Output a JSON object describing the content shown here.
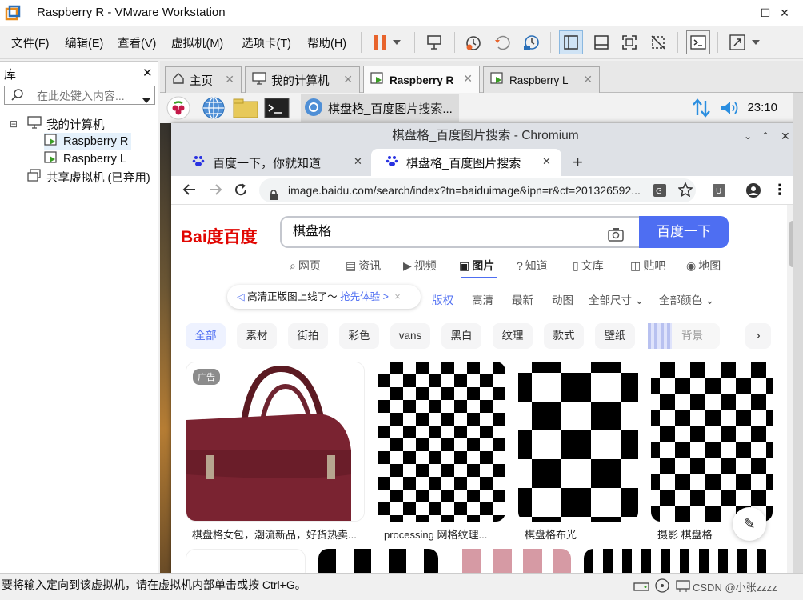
{
  "window": {
    "title": "Raspberry R - VMware Workstation",
    "minimize": "—",
    "maximize": "☐",
    "close": "✕"
  },
  "menu": [
    "文件(F)",
    "编辑(E)",
    "查看(V)",
    "虚拟机(M)",
    "选项卡(T)",
    "帮助(H)"
  ],
  "library": {
    "title": "库",
    "close": "✕",
    "search_placeholder": "在此处键入内容...",
    "tree": [
      {
        "label": "我的计算机",
        "expander": "⊟"
      },
      {
        "label": "Raspberry R"
      },
      {
        "label": "Raspberry L"
      },
      {
        "label": "共享虚拟机 (已弃用)"
      }
    ]
  },
  "vm_tabs": [
    {
      "label": "主页",
      "close": "✕"
    },
    {
      "label": "我的计算机",
      "close": "✕"
    },
    {
      "label": "Raspberry R",
      "close": "✕"
    },
    {
      "label": "Raspberry L",
      "close": "✕"
    }
  ],
  "guest_panel": {
    "taskbar_item": "棋盘格_百度图片搜索...",
    "clock": "23:10"
  },
  "chromium": {
    "title": "棋盘格_百度图片搜索 - Chromium",
    "tabs": [
      {
        "label": "百度一下，你就知道",
        "close": "✕"
      },
      {
        "label": "棋盘格_百度图片搜索",
        "close": "✕"
      }
    ],
    "new_tab": "+",
    "url": "image.baidu.com/search/index?tn=baiduimage&ipn=r&ct=201326592..."
  },
  "baidu": {
    "logo": "Bai度百度",
    "query": "棋盘格",
    "search_button": "百度一下",
    "nav": [
      "网页",
      "资讯",
      "视频",
      "图片",
      "知道",
      "文库",
      "贴吧",
      "地图"
    ],
    "notice": "高清正版图上线了～",
    "notice_link": "抢先体验 >",
    "filters": [
      "版权",
      "高清",
      "最新",
      "动图",
      "全部尺寸",
      "全部颜色"
    ],
    "chips": [
      "全部",
      "素材",
      "街拍",
      "彩色",
      "vans",
      "黑白",
      "纹理",
      "款式",
      "壁纸",
      "背景"
    ],
    "ad_badge": "广告",
    "captions": [
      "棋盘格女包，潮流新品，好货热卖...",
      "processing 网格纹理...",
      "棋盘格布光",
      "摄影 棋盘格"
    ],
    "edit_icon": "✎"
  },
  "status": {
    "text": "要将输入定向到该虚拟机，请在虚拟机内部单击或按 Ctrl+G。",
    "watermark": "CSDN @小张zzzz"
  },
  "colors": {
    "accent": "#4e6ef2",
    "baidu_red": "#e10602",
    "pause_orange": "#e8642c"
  }
}
